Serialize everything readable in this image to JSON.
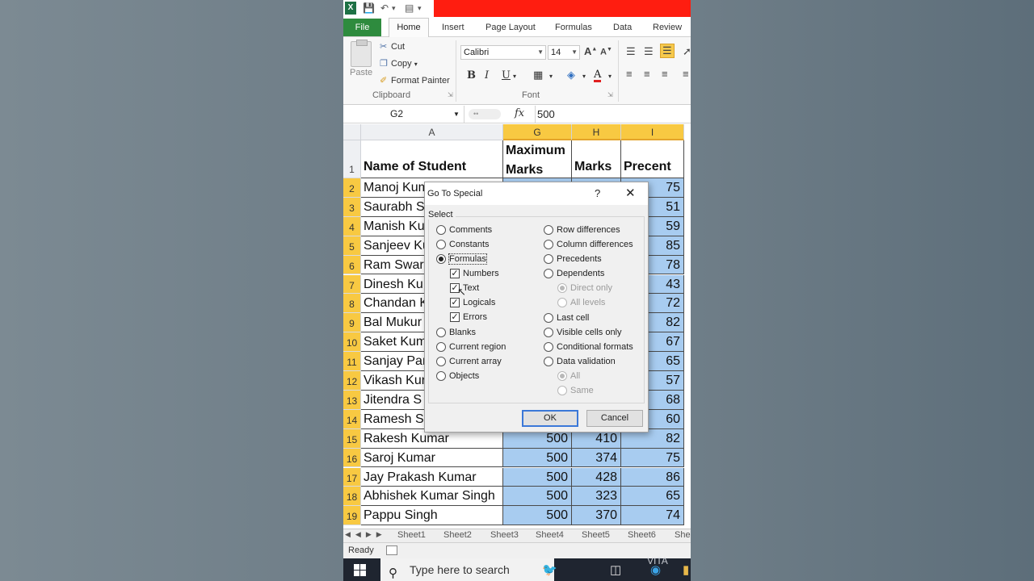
{
  "qat": {
    "app_icon": "X"
  },
  "tabs": {
    "file": "File",
    "home": "Home",
    "insert": "Insert",
    "page_layout": "Page Layout",
    "formulas": "Formulas",
    "data": "Data",
    "review": "Review"
  },
  "ribbon": {
    "paste": "Paste",
    "cut": "Cut",
    "copy": "Copy",
    "format_painter": "Format Painter",
    "clipboard_label": "Clipboard",
    "font_name": "Calibri",
    "font_size": "14",
    "font_label": "Font",
    "bold": "B",
    "italic": "I",
    "underline": "U"
  },
  "formula_bar": {
    "name_box": "G2",
    "fx": "fx",
    "value": "500"
  },
  "grid": {
    "columns": [
      "A",
      "G",
      "H",
      "I"
    ],
    "header_row": {
      "row": "1",
      "a": "Name of Student",
      "g_line1": "Maximum",
      "g_line2": "Marks",
      "h": "Marks",
      "i": "Precent"
    },
    "rows": [
      {
        "n": "2",
        "name": "Manoj Kumar",
        "g": "",
        "h": "",
        "i": "75"
      },
      {
        "n": "3",
        "name": "Saurabh S",
        "g": "",
        "h": "",
        "i": "51"
      },
      {
        "n": "4",
        "name": "Manish Ku",
        "g": "",
        "h": "",
        "i": "59"
      },
      {
        "n": "5",
        "name": "Sanjeev Ku",
        "g": "",
        "h": "",
        "i": "85"
      },
      {
        "n": "6",
        "name": "Ram Swar",
        "g": "",
        "h": "",
        "i": "78"
      },
      {
        "n": "7",
        "name": "Dinesh Ku",
        "g": "",
        "h": "",
        "i": "43"
      },
      {
        "n": "8",
        "name": "Chandan K",
        "g": "",
        "h": "",
        "i": "72"
      },
      {
        "n": "9",
        "name": "Bal Mukur",
        "g": "",
        "h": "",
        "i": "82"
      },
      {
        "n": "10",
        "name": "Saket Kum",
        "g": "",
        "h": "",
        "i": "67"
      },
      {
        "n": "11",
        "name": "Sanjay Par",
        "g": "",
        "h": "",
        "i": "65"
      },
      {
        "n": "12",
        "name": "Vikash Kur",
        "g": "",
        "h": "",
        "i": "57"
      },
      {
        "n": "13",
        "name": "Jitendra S",
        "g": "",
        "h": "",
        "i": "68"
      },
      {
        "n": "14",
        "name": "Ramesh Si",
        "g": "",
        "h": "",
        "i": "60"
      },
      {
        "n": "15",
        "name": "Rakesh Kumar",
        "g": "500",
        "h": "410",
        "i": "82"
      },
      {
        "n": "16",
        "name": "Saroj Kumar",
        "g": "500",
        "h": "374",
        "i": "75"
      },
      {
        "n": "17",
        "name": "Jay Prakash Kumar",
        "g": "500",
        "h": "428",
        "i": "86"
      },
      {
        "n": "18",
        "name": "Abhishek Kumar Singh",
        "g": "500",
        "h": "323",
        "i": "65"
      },
      {
        "n": "19",
        "name": "Pappu Singh",
        "g": "500",
        "h": "370",
        "i": "74"
      }
    ]
  },
  "sheets": [
    "Sheet1",
    "Sheet2",
    "Sheet3",
    "Sheet4",
    "Sheet5",
    "Sheet6",
    "She"
  ],
  "status": {
    "text": "Ready"
  },
  "taskbar": {
    "search_placeholder": "Type here to search"
  },
  "watermark": "VITA",
  "dialog": {
    "title": "Go To Special",
    "help": "?",
    "close": "✕",
    "group_label": "Select",
    "left_options": [
      {
        "label": "Comments",
        "state": "off"
      },
      {
        "label": "Constants",
        "state": "off"
      },
      {
        "label": "Formulas",
        "state": "on"
      }
    ],
    "formula_checks": [
      {
        "label": "Numbers",
        "checked": "✓"
      },
      {
        "label": "Text",
        "checked": "✓"
      },
      {
        "label": "Logicals",
        "checked": "✓"
      },
      {
        "label": "Errors",
        "checked": "✓"
      }
    ],
    "left_options_2": [
      {
        "label": "Blanks"
      },
      {
        "label": "Current region"
      },
      {
        "label": "Current array"
      },
      {
        "label": "Objects"
      }
    ],
    "right_options": [
      {
        "label": "Row differences"
      },
      {
        "label": "Column differences"
      },
      {
        "label": "Precedents"
      },
      {
        "label": "Dependents"
      }
    ],
    "dependents_sub": [
      {
        "label": "Direct only"
      },
      {
        "label": "All levels"
      }
    ],
    "right_options_2": [
      {
        "label": "Last cell"
      },
      {
        "label": "Visible cells only"
      },
      {
        "label": "Conditional formats"
      },
      {
        "label": "Data validation"
      }
    ],
    "validation_sub": [
      {
        "label": "All"
      },
      {
        "label": "Same"
      }
    ],
    "ok": "OK",
    "cancel": "Cancel"
  },
  "colors": {
    "file_tab": "#2e8b3e",
    "selection_fill": "#a8ccf0",
    "selected_header": "#f8c942",
    "top_bar": "#ff1d10"
  }
}
